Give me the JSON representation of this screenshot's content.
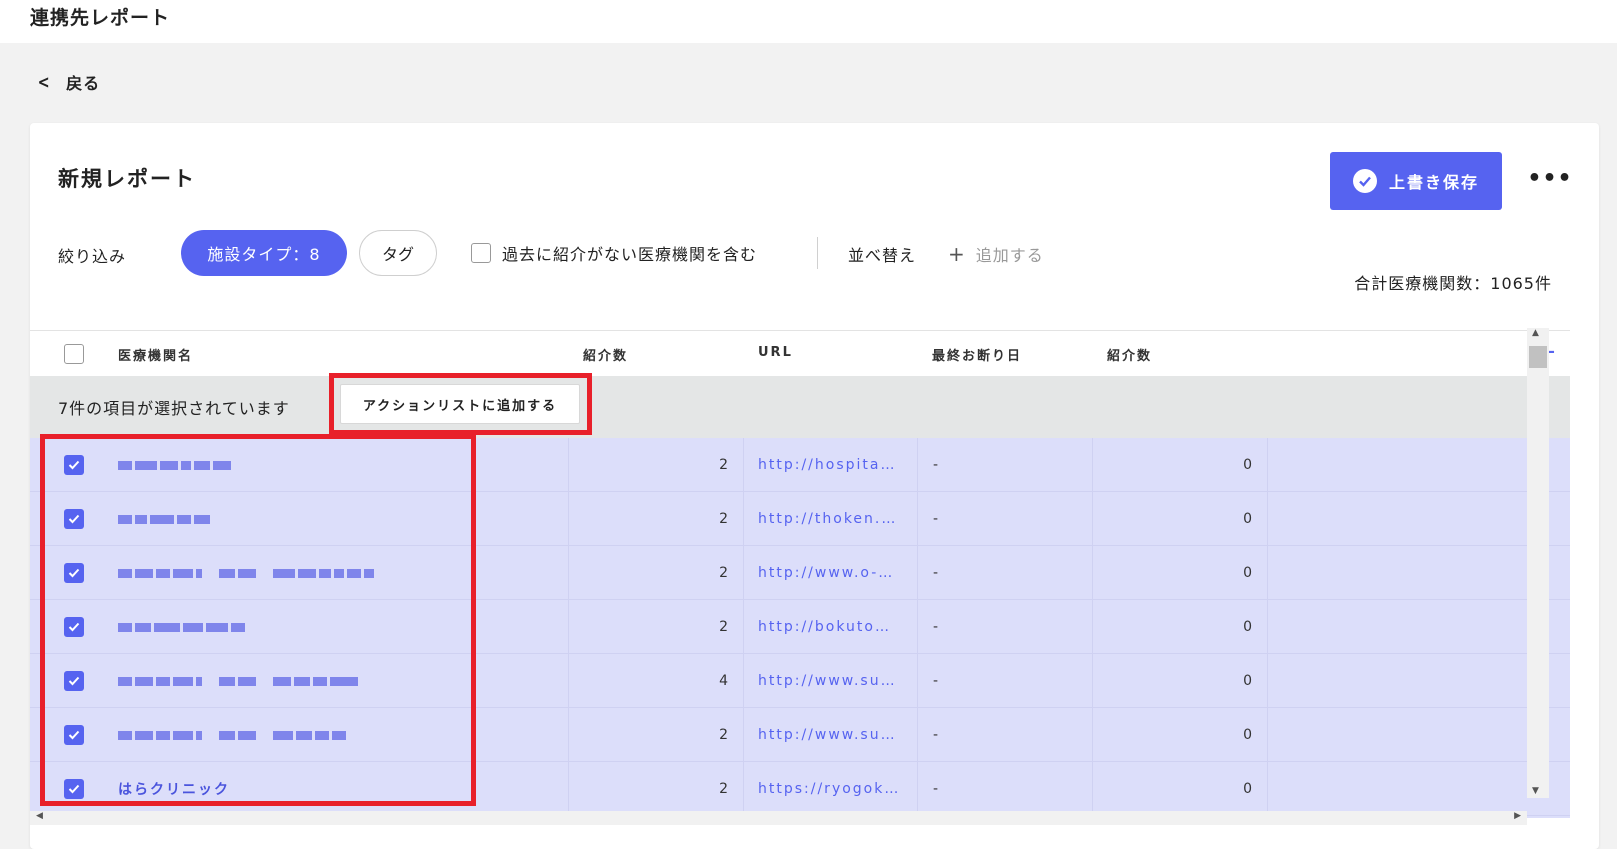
{
  "app": {
    "title": "連携先レポート"
  },
  "nav": {
    "back_label": "戻る"
  },
  "report": {
    "title": "新規レポート",
    "save_label": "上書き保存",
    "more_label": "•••"
  },
  "filters": {
    "label": "絞り込み",
    "facility_chip": "施設タイプ：8",
    "tag_chip": "タグ",
    "past_checkbox_label": "過去に紹介がない医療機関を含む",
    "sort_label": "並べ替え",
    "add_label": "追加する"
  },
  "summary": {
    "total": "合計医療機関数：1065件"
  },
  "table": {
    "columns": [
      "医療機関名",
      "紹介数",
      "URL",
      "最終お断り日",
      "紹介数"
    ],
    "selection_text": "7件の項目が選択されています",
    "action_label": "アクションリストに追加する",
    "rows": [
      {
        "name": "",
        "referrals": "2",
        "url": "http://hospita…",
        "last_decline": "-",
        "count": "0"
      },
      {
        "name": "",
        "referrals": "2",
        "url": "http://thoken.…",
        "last_decline": "-",
        "count": "0"
      },
      {
        "name": "",
        "referrals": "2",
        "url": "http://www.o-…",
        "last_decline": "-",
        "count": "0"
      },
      {
        "name": "",
        "referrals": "2",
        "url": "http://bokuto…",
        "last_decline": "-",
        "count": "0"
      },
      {
        "name": "",
        "referrals": "4",
        "url": "http://www.su…",
        "last_decline": "-",
        "count": "0"
      },
      {
        "name": "",
        "referrals": "2",
        "url": "http://www.su…",
        "last_decline": "-",
        "count": "0"
      },
      {
        "name": "はらクリニック",
        "referrals": "2",
        "url": "https://ryogok…",
        "last_decline": "-",
        "count": "0"
      }
    ]
  },
  "colors": {
    "accent": "#5663f0",
    "highlight": "#e8202a",
    "row_bg": "#dcdefa"
  }
}
